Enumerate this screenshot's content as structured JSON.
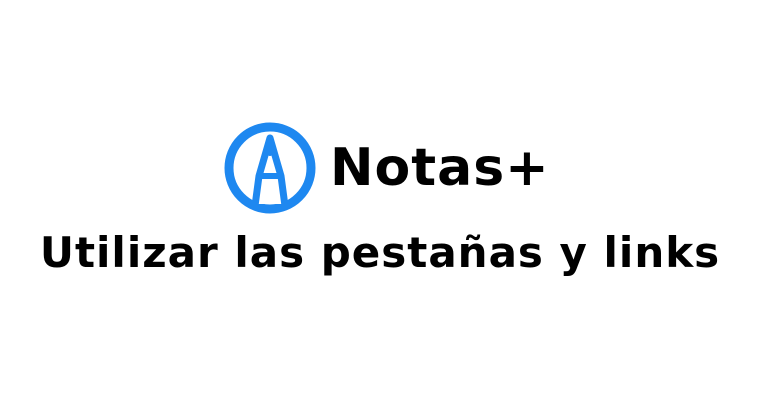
{
  "logo": {
    "icon": "pen-nib-icon",
    "color": "#1E88F0"
  },
  "app_name": "Notas+",
  "subtitle": "Utilizar las pestañas y links"
}
